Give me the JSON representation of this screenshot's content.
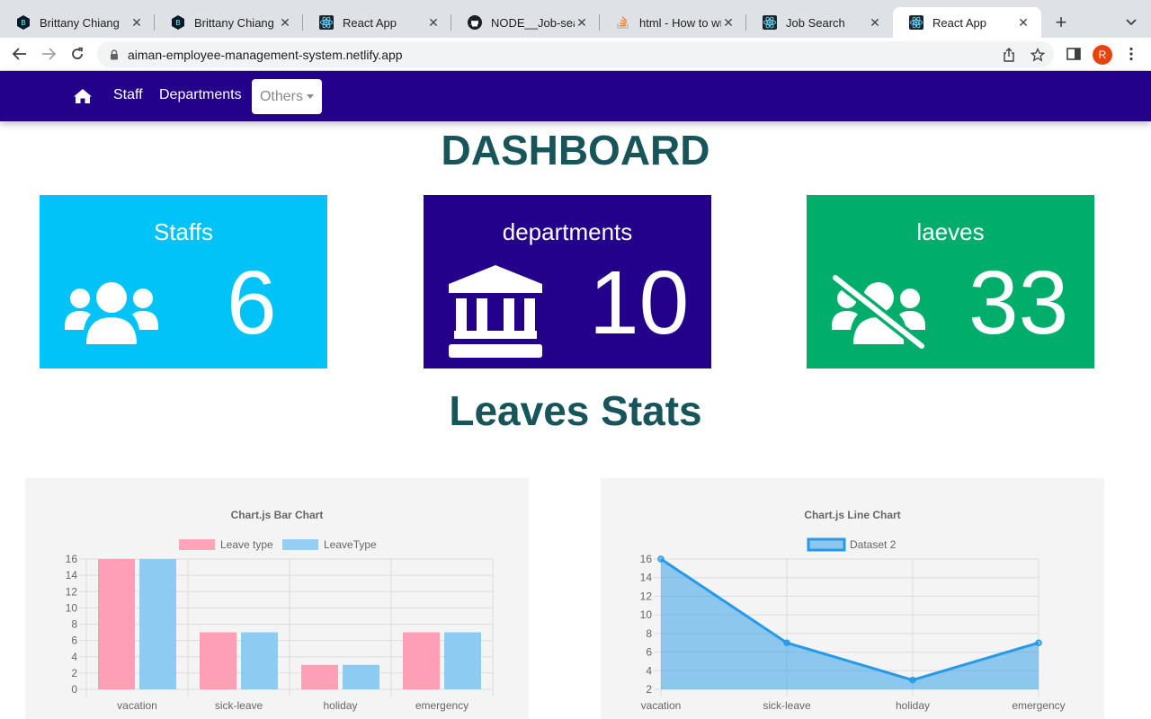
{
  "browser": {
    "tabs": [
      {
        "title": "Brittany Chiang",
        "icon": "hexagon-b-icon",
        "active": false
      },
      {
        "title": "Brittany Chiang",
        "icon": "hexagon-b-icon",
        "active": false
      },
      {
        "title": "React App",
        "icon": "react-icon",
        "active": false
      },
      {
        "title": "NODE__Job-searc",
        "icon": "github-icon",
        "active": false
      },
      {
        "title": "html - How to wra",
        "icon": "stackoverflow-icon",
        "active": false
      },
      {
        "title": "Job Search",
        "icon": "react-icon",
        "active": false
      },
      {
        "title": "React App",
        "icon": "react-icon",
        "active": true
      }
    ],
    "url": "aiman-employee-management-system.netlify.app",
    "profile_initial": "R"
  },
  "nav": {
    "links": [
      "Staff",
      "Departments"
    ],
    "dropdown_label": "Others",
    "color": "#23018b"
  },
  "page": {
    "title": "DASHBOARD",
    "section_title": "Leaves Stats"
  },
  "cards": [
    {
      "label": "Staffs",
      "count": "6",
      "icon": "users-icon",
      "color": "#01c3f8"
    },
    {
      "label": "departments",
      "count": "10",
      "icon": "building-columns-icon",
      "color": "#23018b"
    },
    {
      "label": "laeves",
      "count": "33",
      "icon": "users-slash-icon",
      "color": "#01ad6b"
    }
  ],
  "chart_data": [
    {
      "type": "bar",
      "title": "Chart.js Bar Chart",
      "categories": [
        "vacation",
        "sick-leave",
        "holiday",
        "emergency"
      ],
      "series": [
        {
          "name": "Leave type",
          "values": [
            16,
            7,
            3,
            7
          ],
          "color": "#ff9fb7"
        },
        {
          "name": "LeaveType",
          "values": [
            16,
            7,
            3,
            7
          ],
          "color": "#8ecbf2"
        }
      ],
      "ylim": [
        0,
        16
      ],
      "yticks": [
        0,
        2,
        4,
        6,
        8,
        10,
        12,
        14,
        16
      ],
      "legend": "top",
      "grid": true
    },
    {
      "type": "area",
      "title": "Chart.js Line Chart",
      "categories": [
        "vacation",
        "sick-leave",
        "holiday",
        "emergency"
      ],
      "series": [
        {
          "name": "Dataset 2",
          "values": [
            16,
            7,
            3,
            7
          ],
          "color": "#259ae8"
        }
      ],
      "ylim": [
        2,
        16
      ],
      "yticks": [
        2,
        4,
        6,
        8,
        10,
        12,
        14,
        16
      ],
      "legend": "top",
      "grid": true
    }
  ]
}
